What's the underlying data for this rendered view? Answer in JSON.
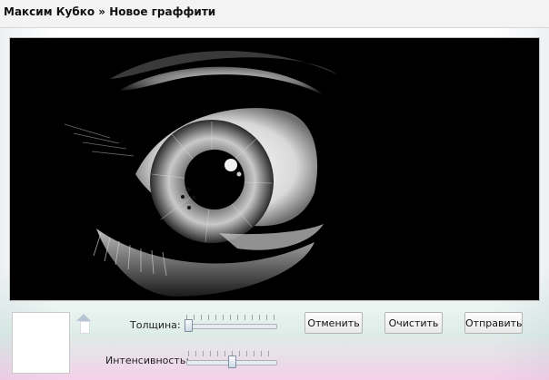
{
  "header": {
    "title": "Максим Кубко » Новое граффити"
  },
  "canvas": {
    "content": "black-and-white eye drawing",
    "background": "#000000"
  },
  "controls": {
    "thickness_label": "Толщина:",
    "thickness_value": 0.0,
    "intensity_label": "Интенсивность:",
    "intensity_value": 0.5
  },
  "buttons": {
    "undo_label": "Отменить",
    "clear_label": "Очистить",
    "send_label": "Отправить"
  },
  "colors": {
    "canvas_bg": "#000000",
    "panel_bg": "#ffffff",
    "title_bg": "#f3f3f3"
  }
}
